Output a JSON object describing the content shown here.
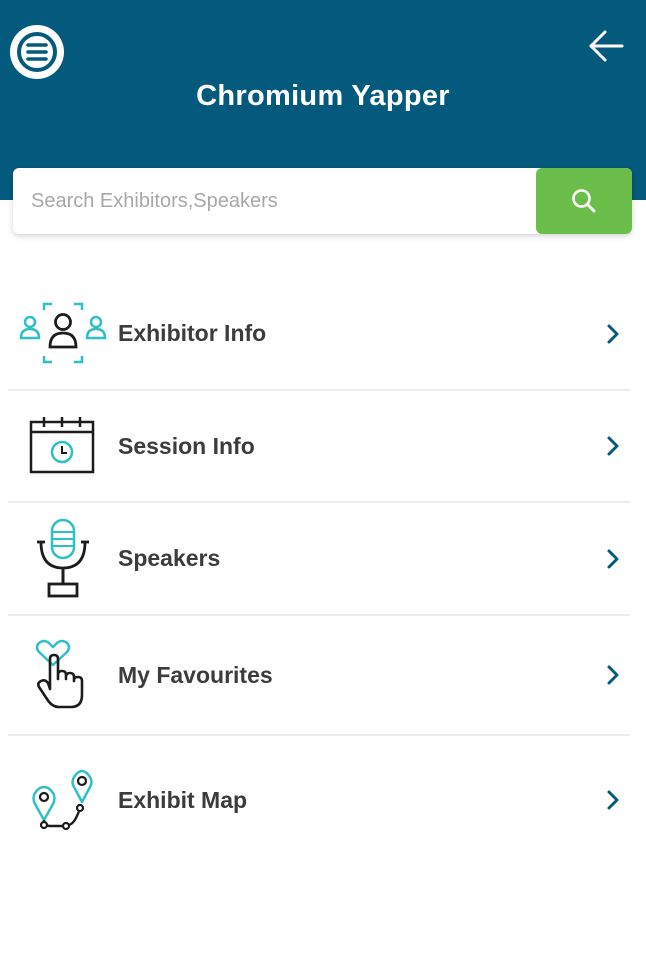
{
  "header": {
    "title": "Chromium Yapper",
    "menu_icon": "hamburger-menu-icon",
    "back_icon": "arrow-left-icon",
    "background_color": "#045a7d"
  },
  "search": {
    "placeholder": "Search Exhibitors,Speakers",
    "value": "",
    "button_icon": "search-icon",
    "button_color": "#6cbe4a"
  },
  "menu": {
    "items": [
      {
        "label": "Exhibitor Info",
        "icon": "exhibitor-people-icon"
      },
      {
        "label": "Session Info",
        "icon": "calendar-clock-icon"
      },
      {
        "label": "Speakers",
        "icon": "microphone-icon"
      },
      {
        "label": "My Favourites",
        "icon": "heart-hand-icon"
      },
      {
        "label": "Exhibit Map",
        "icon": "map-route-icon"
      }
    ],
    "chevron_icon": "chevron-right-icon",
    "accent_color": "#2dc0c6"
  }
}
